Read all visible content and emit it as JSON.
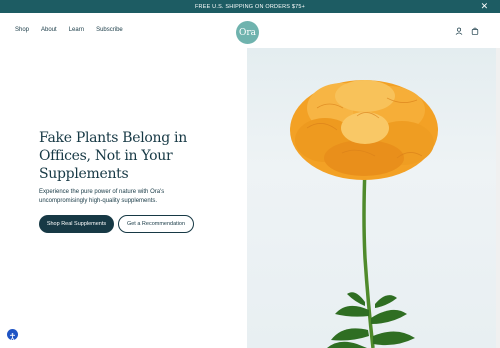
{
  "announcement": {
    "text": "FREE U.S. SHIPPING ON ORDERS $75+",
    "close_icon": "close-icon"
  },
  "nav": {
    "links": [
      "Shop",
      "About",
      "Learn",
      "Subscribe"
    ],
    "logo": "Ora",
    "icons": [
      "account-icon",
      "cart-icon"
    ]
  },
  "hero": {
    "headline": "Fake Plants Belong in Offices, Not in Your Supplements",
    "subtext": "Experience the pure power of nature with Ora's uncompromisingly high-quality supplements.",
    "primary_cta": "Shop Real Supplements",
    "secondary_cta": "Get a Recommendation",
    "image_icon": "marigold-flower-image"
  },
  "accessibility": {
    "icon": "accessibility-icon"
  },
  "colors": {
    "announcement_bg": "#1d5c63",
    "brand_dark": "#173945",
    "logo_bg": "#6fb3ae",
    "flower_orange": "#f5a32a",
    "a11y_blue": "#1f54c4"
  }
}
